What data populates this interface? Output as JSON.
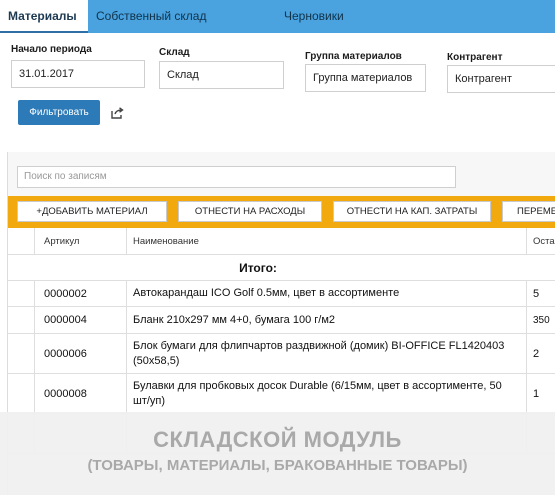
{
  "tabs": [
    {
      "label": "Материалы",
      "active": true
    },
    {
      "label": "Собственный склад"
    },
    {
      "label": "Черновики"
    }
  ],
  "filters": {
    "period": {
      "label": "Начало периода",
      "value": "31.01.2017"
    },
    "warehouse": {
      "label": "Склад",
      "value": "Склад"
    },
    "group": {
      "label": "Группа материалов",
      "value": "Группа материалов"
    },
    "counterparty": {
      "label": "Контрагент",
      "value": "Контрагент"
    },
    "filter_button": "Фильтровать",
    "export_icon": "external-link-icon"
  },
  "search": {
    "placeholder": "Поиск по записям"
  },
  "actions": [
    "+ДОБАВИТЬ МАТЕРИАЛ",
    "ОТНЕСТИ НА РАСХОДЫ",
    "ОТНЕСТИ НА КАП. ЗАТРАТЫ",
    "ПЕРЕМЕ"
  ],
  "table": {
    "columns": [
      "",
      "Артикул",
      "Наименование",
      "Оста"
    ],
    "total_label": "Итого:",
    "rows": [
      {
        "article": "0000002",
        "name": "Автокарандаш ICO Golf 0.5мм, цвет в ассортименте",
        "qty": "5"
      },
      {
        "article": "0000004",
        "name": "Бланк 210x297 мм 4+0, бумага 100 г/м2",
        "qty": "350"
      },
      {
        "article": "0000006",
        "name": "Блок бумаги для флипчартов раздвижной (домик) BI-OFFICE FL1420403 (50x58,5)",
        "qty": "2"
      },
      {
        "article": "0000008",
        "name": "Булавки для пробковых досок Durable (6/15мм, цвет в ассортименте, 50 шт/уп)",
        "qty": "1"
      }
    ]
  },
  "banner": {
    "title": "СКЛАДСКОЙ МОДУЛЬ",
    "subtitle": "(ТОВАРЫ, МАТЕРИАЛЫ, БРАКОВАННЫЕ ТОВАРЫ)"
  },
  "colors": {
    "tabbar": "#4aa3df",
    "primary_button": "#2d7ab8",
    "action_bar": "#f1a90d"
  }
}
